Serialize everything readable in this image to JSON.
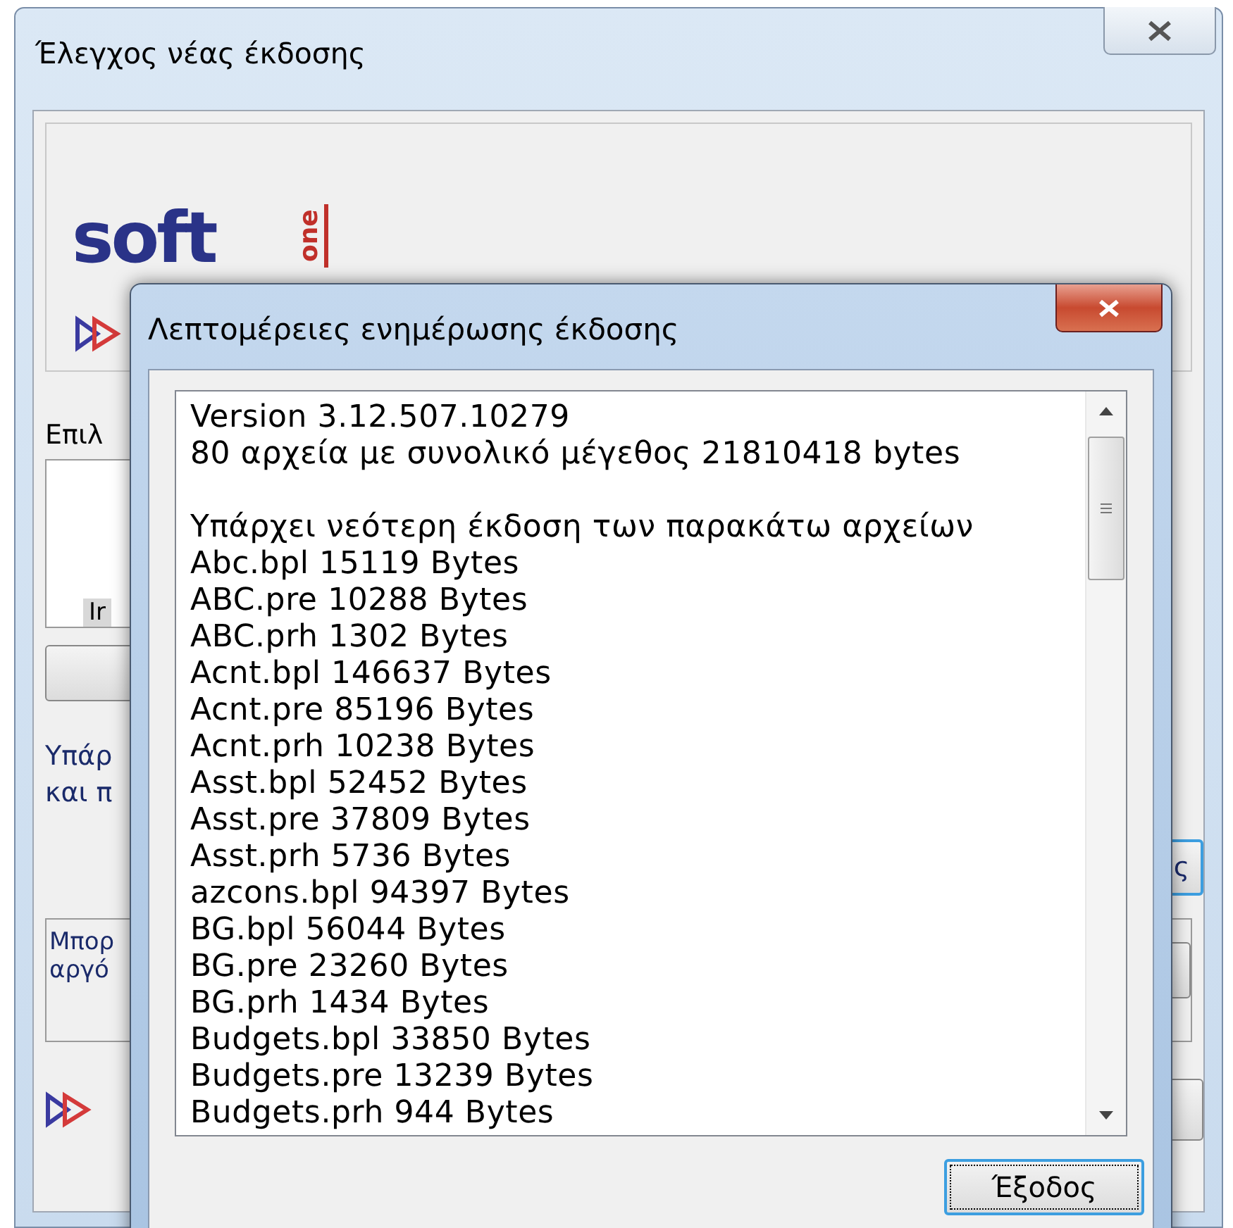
{
  "main_window": {
    "title": "Έλεγχος νέας έκδοσης",
    "logo": {
      "word": "soft",
      "badge": "one"
    },
    "select_label": "Επιλ",
    "list_items": [
      {
        "text": "Ir",
        "selected": true
      }
    ],
    "message_lines": [
      "Υπάρ",
      "και π"
    ],
    "side_button": {
      "label": "ς",
      "focused": true
    },
    "info_lines": [
      "Μπορ",
      "αργό"
    ]
  },
  "dialog": {
    "title": "Λεπτομέρειες ενημέρωσης έκδοσης",
    "header_lines": [
      "Version 3.12.507.10279",
      "80 αρχεία με συνολικό μέγεθος 21810418 bytes"
    ],
    "files_heading": "Υπάρχει νεότερη έκδοση των παρακάτω αρχείων",
    "files": [
      "Abc.bpl 15119 Bytes",
      "ABC.pre 10288 Bytes",
      "ABC.prh 1302 Bytes",
      "Acnt.bpl 146637 Bytes",
      "Acnt.pre 85196 Bytes",
      "Acnt.prh 10238 Bytes",
      "Asst.bpl 52452 Bytes",
      "Asst.pre 37809 Bytes",
      "Asst.prh 5736 Bytes",
      "azcons.bpl 94397 Bytes",
      "BG.bpl 56044 Bytes",
      "BG.pre 23260 Bytes",
      "BG.prh 1434 Bytes",
      "Budgets.bpl 33850 Bytes",
      "Budgets.pre 13239 Bytes",
      "Budgets.prh 944 Bytes"
    ],
    "exit_button": {
      "label": "Έξοδος",
      "focused": true
    }
  }
}
